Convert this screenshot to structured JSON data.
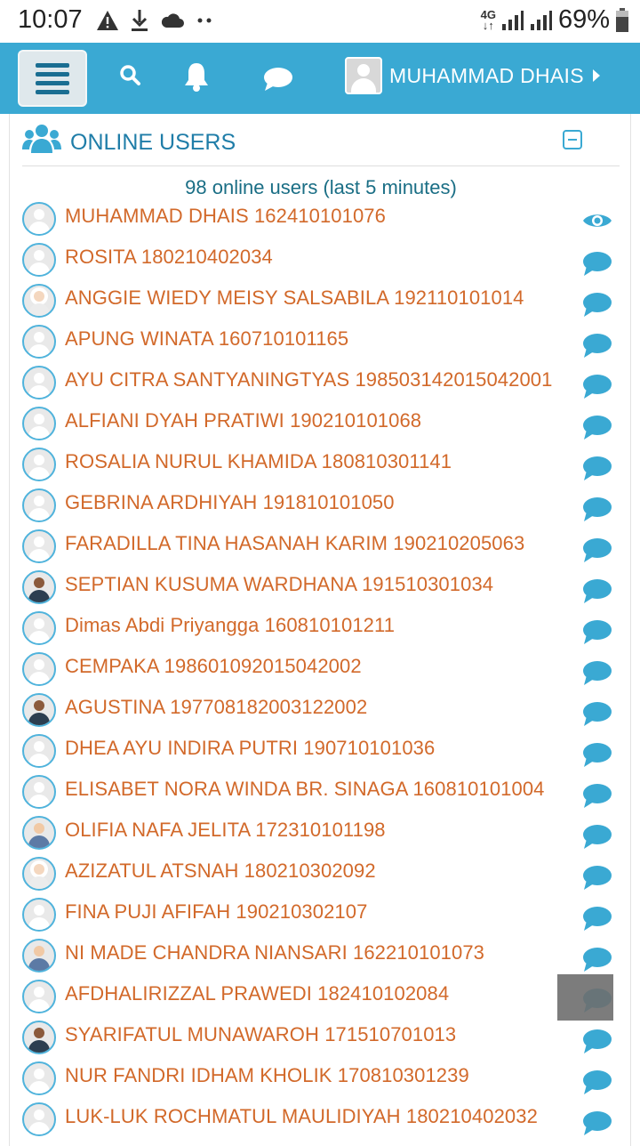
{
  "status_bar": {
    "time": "10:07",
    "battery_percent": "69%",
    "network": "4G",
    "icons": [
      "warning-icon",
      "download-icon",
      "cloud-icon",
      "more-dots-icon",
      "signal-icon",
      "signal-icon",
      "battery-icon"
    ]
  },
  "navbar": {
    "background": "#3aa9d3",
    "icons": [
      "hamburger-menu-icon",
      "search-icon",
      "bell-icon",
      "chat-icon"
    ],
    "user_name": "MUHAMMAD DHAIS"
  },
  "panel": {
    "title": "ONLINE USERS",
    "subtitle": "98 online users (last 5 minutes)",
    "name_color": "#d2692a",
    "accent_color": "#3aa9d3"
  },
  "users": [
    {
      "name": "MUHAMMAD DHAIS 162410101076",
      "avatar": "default",
      "action_icon": "eye-icon"
    },
    {
      "name": "ROSITA 180210402034",
      "avatar": "default",
      "action_icon": "message-icon"
    },
    {
      "name": "ANGGIE WIEDY MEISY SALSABILA 192110101014",
      "avatar": "hijab",
      "action_icon": "message-icon"
    },
    {
      "name": "APUNG WINATA 160710101165",
      "avatar": "default",
      "action_icon": "message-icon"
    },
    {
      "name": "AYU CITRA SANTYANINGTYAS 198503142015042001",
      "avatar": "default",
      "action_icon": "message-icon"
    },
    {
      "name": "ALFIANI DYAH PRATIWI 190210101068",
      "avatar": "default",
      "action_icon": "message-icon"
    },
    {
      "name": "ROSALIA NURUL KHAMIDA 180810301141",
      "avatar": "default",
      "action_icon": "message-icon"
    },
    {
      "name": "GEBRINA ARDHIYAH 191810101050",
      "avatar": "default",
      "action_icon": "message-icon"
    },
    {
      "name": "FARADILLA TINA HASANAH KARIM 190210205063",
      "avatar": "default",
      "action_icon": "message-icon"
    },
    {
      "name": "SEPTIAN KUSUMA WARDHANA 191510301034",
      "avatar": "dark",
      "action_icon": "message-icon"
    },
    {
      "name": "Dimas Abdi Priyangga 160810101211",
      "avatar": "default",
      "action_icon": "message-icon"
    },
    {
      "name": "CEMPAKA 198601092015042002",
      "avatar": "default",
      "action_icon": "message-icon"
    },
    {
      "name": "AGUSTINA 197708182003122002",
      "avatar": "dark",
      "action_icon": "message-icon"
    },
    {
      "name": "DHEA AYU INDIRA PUTRI 190710101036",
      "avatar": "default",
      "action_icon": "message-icon"
    },
    {
      "name": "ELISABET NORA WINDA BR. SINAGA 160810101004",
      "avatar": "default",
      "action_icon": "message-icon"
    },
    {
      "name": "OLIFIA NAFA JELITA 172310101198",
      "avatar": "photo",
      "action_icon": "message-icon"
    },
    {
      "name": "AZIZATUL ATSNAH 180210302092",
      "avatar": "hijab",
      "action_icon": "message-icon"
    },
    {
      "name": "FINA PUJI AFIFAH 190210302107",
      "avatar": "default",
      "action_icon": "message-icon"
    },
    {
      "name": "NI MADE CHANDRA NIANSARI 162210101073",
      "avatar": "photo",
      "action_icon": "message-icon"
    },
    {
      "name": "AFDHALIRIZZAL PRAWEDI 182410102084",
      "avatar": "default",
      "action_icon": "message-icon"
    },
    {
      "name": "SYARIFATUL MUNAWAROH 171510701013",
      "avatar": "dark",
      "action_icon": "message-icon"
    },
    {
      "name": "NUR FANDRI IDHAM KHOLIK 170810301239",
      "avatar": "default",
      "action_icon": "message-icon"
    },
    {
      "name": "LUK-LUK ROCHMATUL MAULIDIYAH 180210402032",
      "avatar": "default",
      "action_icon": "message-icon"
    }
  ]
}
